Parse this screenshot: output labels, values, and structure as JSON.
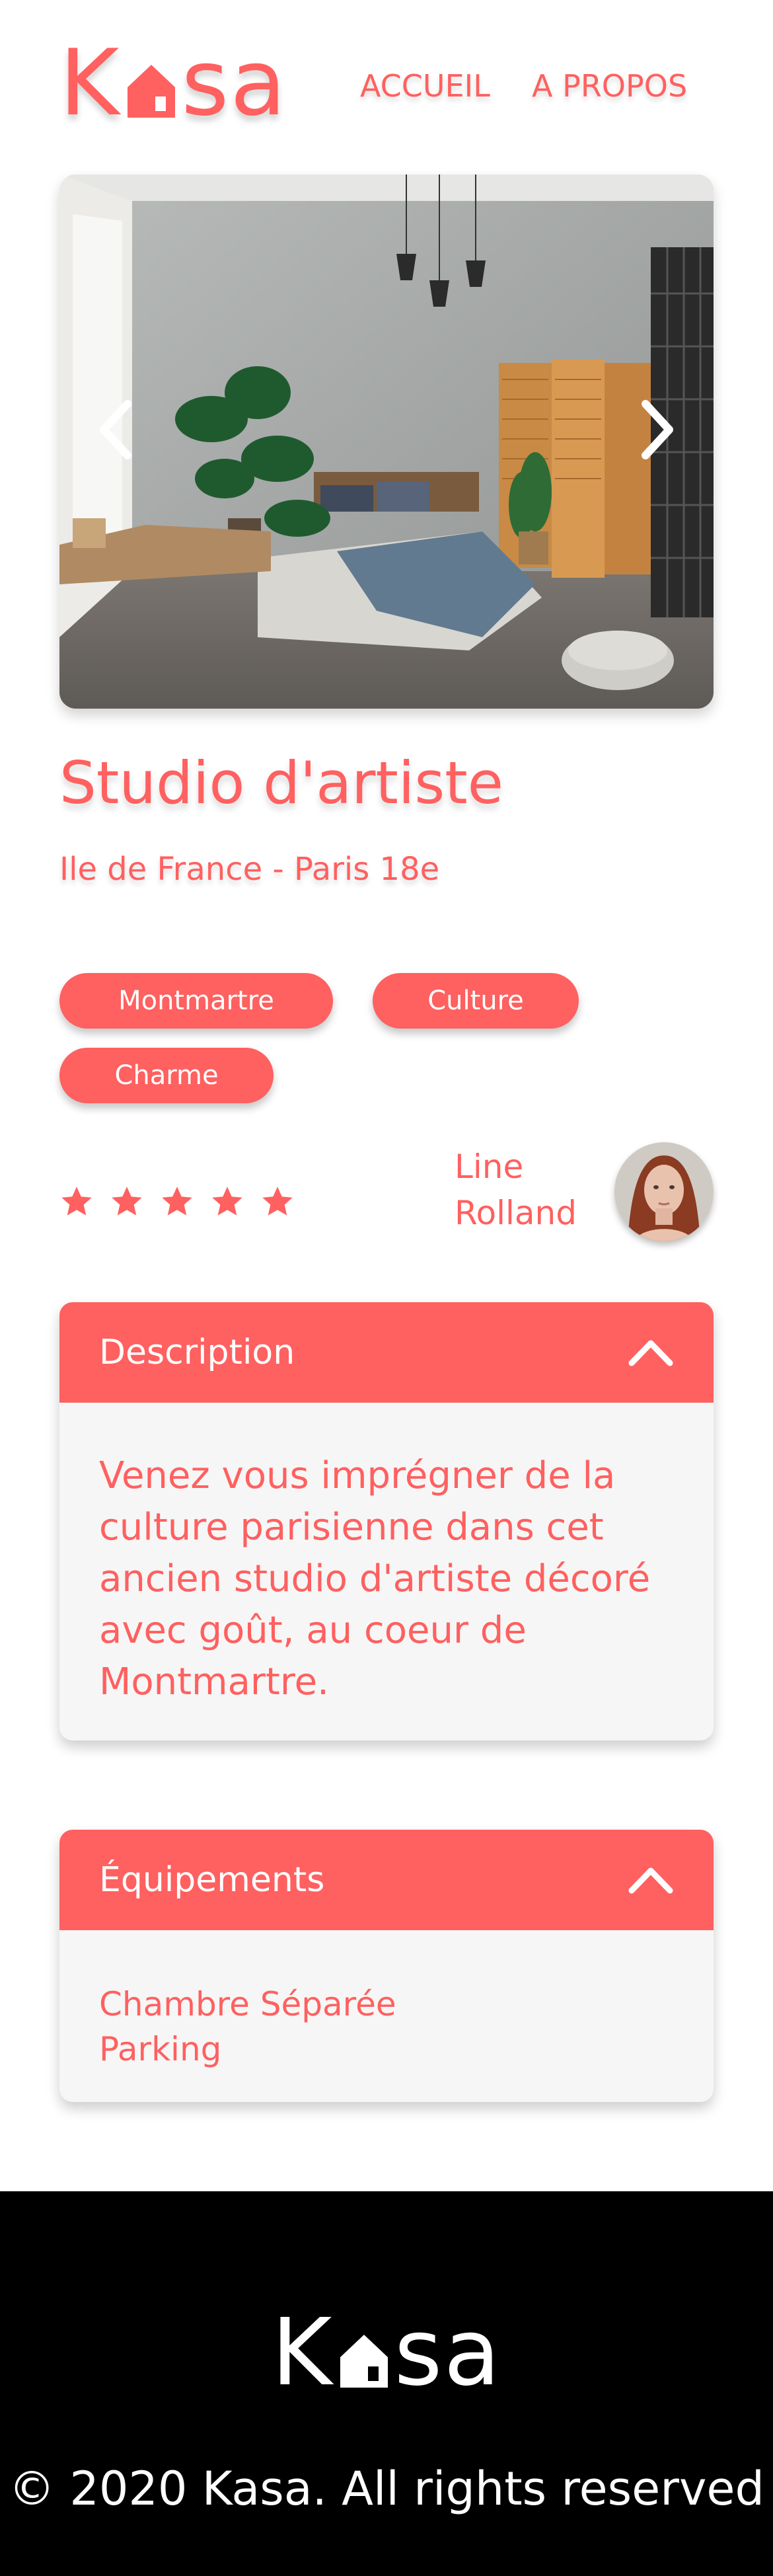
{
  "header": {
    "logo_k": "K",
    "logo_sa": "sa",
    "nav_home": "ACCUEIL",
    "nav_about": "A PROPOS"
  },
  "gallery": {
    "prev_icon": "chevron-left-icon",
    "next_icon": "chevron-right-icon"
  },
  "listing": {
    "title": "Studio d'artiste",
    "location": "Ile de France - Paris 18e",
    "tags": [
      "Montmartre",
      "Culture",
      "Charme"
    ],
    "rating": 5,
    "rating_max": 5
  },
  "host": {
    "name": "Line Rolland"
  },
  "description": {
    "title": "Description",
    "text": "Venez vous imprégner de la culture parisienne dans cet ancien studio d'artiste décoré avec goût, au coeur de Montmartre."
  },
  "equipments": {
    "title": "Équipements",
    "items": [
      "Chambre Séparée",
      "Parking"
    ]
  },
  "footer": {
    "logo_k": "K",
    "logo_sa": "sa",
    "copyright": "© 2020 Kasa. All rights reserved"
  },
  "colors": {
    "accent": "#FF6060",
    "panel": "#F6F6F6",
    "footer_bg": "#000000"
  }
}
